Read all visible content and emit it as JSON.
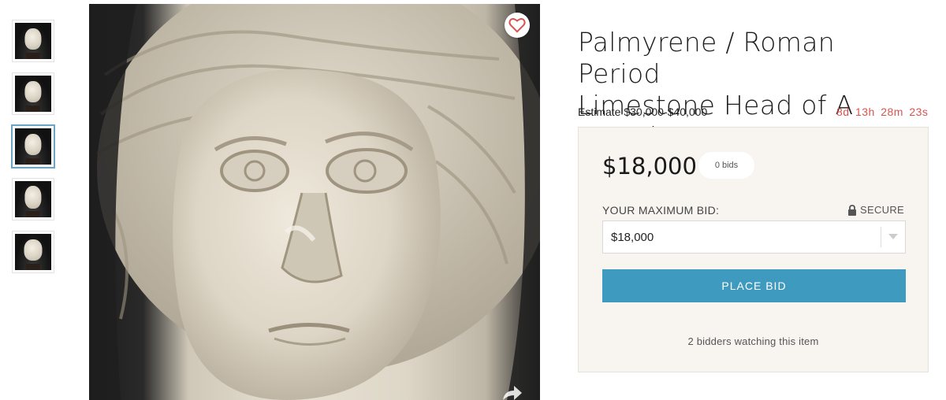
{
  "gallery": {
    "thumbnails": [
      "thumbnail-1",
      "thumbnail-2",
      "thumbnail-3",
      "thumbnail-4",
      "thumbnail-5"
    ],
    "active_index": 2
  },
  "lot": {
    "title_line1": "Palmyrene / Roman Period",
    "title_line2": "Limestone Head of A Female",
    "estimate": "Estimate $30,000-$40,000",
    "countdown": "8d 13h 28m 23s"
  },
  "bid_panel": {
    "current_price": "$18,000",
    "bids_count": "0 bids",
    "max_bid_label": "YOUR MAXIMUM BID:",
    "secure_label": "SECURE",
    "bid_value": "$18,000",
    "place_bid_label": "PLACE BID",
    "watching_text": "2 bidders watching this item"
  },
  "colors": {
    "accent": "#3f9ac0",
    "countdown": "#d9544f",
    "heart": "#d9544f",
    "panel_bg": "#f8f5f1"
  },
  "icons": {
    "favorite": "heart-icon",
    "share": "share-icon",
    "secure": "lock-icon",
    "dropdown": "chevron-down-icon"
  }
}
